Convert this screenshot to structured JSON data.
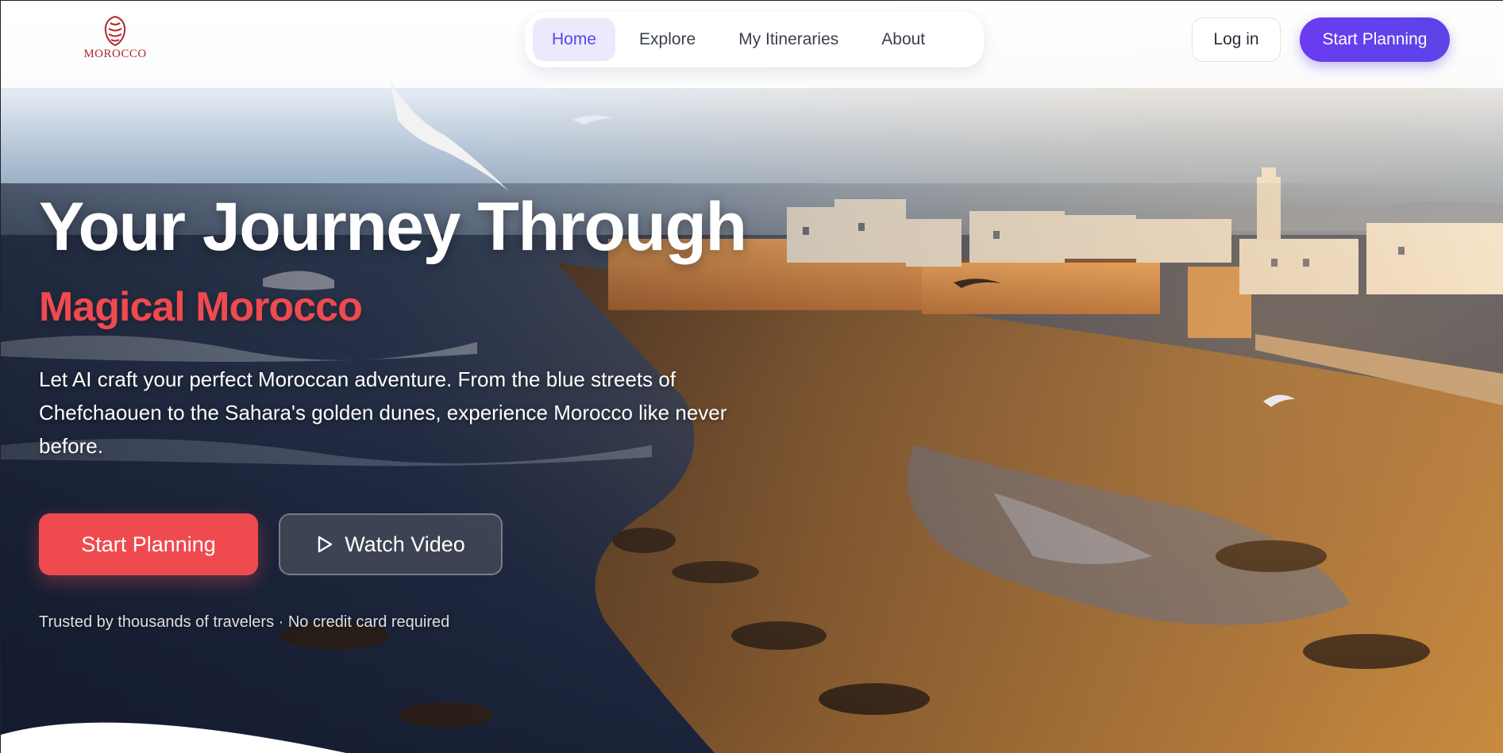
{
  "brand": {
    "logo_text": "MOROCCO",
    "logo_icon": "morocco-emblem-icon",
    "logo_color": "#b3262b"
  },
  "nav": {
    "items": [
      {
        "label": "Home",
        "active": true
      },
      {
        "label": "Explore",
        "active": false
      },
      {
        "label": "My Itineraries",
        "active": false
      },
      {
        "label": "About",
        "active": false
      }
    ]
  },
  "header_actions": {
    "login_label": "Log in",
    "start_label": "Start Planning"
  },
  "hero": {
    "headline": "Your Journey Through",
    "subheadline": "Magical Morocco",
    "description": "Let AI craft your perfect Moroccan adventure. From the blue streets of Chefchaouen to the Sahara's golden dunes, experience Morocco like never before.",
    "primary_cta": "Start Planning",
    "secondary_cta": "Watch Video",
    "secondary_cta_icon": "play-icon",
    "trust_line": "Trusted by thousands of travelers · No credit card required"
  },
  "colors": {
    "accent_purple": "#5b45e6",
    "accent_red": "#ef4a4f",
    "nav_active_bg": "#ebeafc"
  }
}
